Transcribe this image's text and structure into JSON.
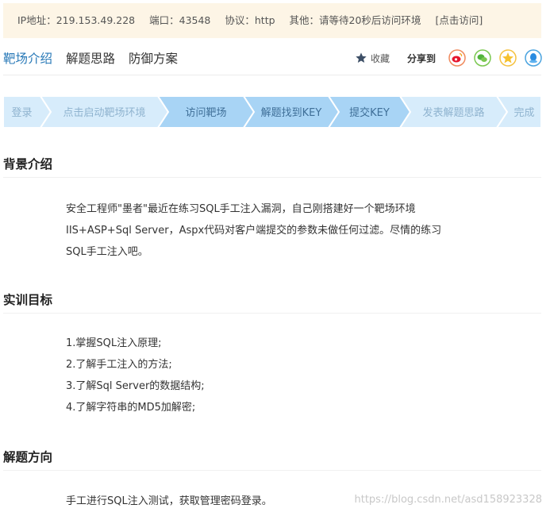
{
  "infobar": {
    "ip": "IP地址：219.153.49.228",
    "port": "端口：43548",
    "protocol": "协议：http",
    "other": "其他：请等待20秒后访问环境",
    "action": "[点击访问]"
  },
  "tabs": [
    "靶场介绍",
    "解题思路",
    "防御方案"
  ],
  "actions": {
    "favorite": "收藏",
    "share": "分享到",
    "icons": [
      "weibo-icon",
      "wechat-icon",
      "qzone-icon",
      "qq-icon"
    ]
  },
  "steps": [
    "登录",
    "点击启动靶场环境",
    "访问靶场",
    "解题找到KEY",
    "提交KEY",
    "发表解题思路",
    "完成"
  ],
  "colors": {
    "accent": "#2a7ab8",
    "step_active": "#a8d4f5",
    "step_inactive": "#d7ecfb",
    "step_active_text": "#3f6f98",
    "step_inactive_text": "#8fb3cf",
    "infobar_bg": "#fdf5e6"
  },
  "sections": [
    {
      "title": "背景介绍",
      "lines": [
        "安全工程师\"墨者\"最近在练习SQL手工注入漏洞，自己刚搭建好一个靶场环境",
        "IIS+ASP+Sql Server，Aspx代码对客户端提交的参数未做任何过滤。尽情的练习",
        "SQL手工注入吧。"
      ]
    },
    {
      "title": "实训目标",
      "lines": [
        "1.掌握SQL注入原理;",
        "2.了解手工注入的方法;",
        "3.了解Sql Server的数据结构;",
        "4.了解字符串的MD5加解密;"
      ]
    },
    {
      "title": "解题方向",
      "lines": [
        "手工进行SQL注入测试，获取管理密码登录。"
      ]
    }
  ],
  "watermark": "https://blog.csdn.net/asd158923328"
}
